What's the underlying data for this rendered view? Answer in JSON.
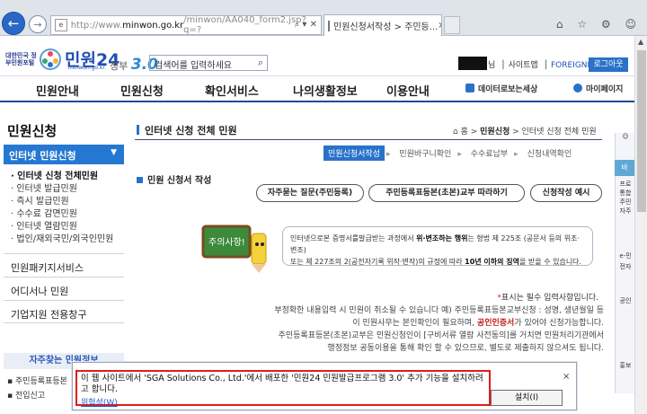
{
  "browser": {
    "url_prefix": "http://www.",
    "url_domain": "minwon.go.kr",
    "url_path": "/minwon/AA040_form2.jsp?q=?",
    "tab_title": "민원신청서작성 > 주민등...",
    "tab_close": "×",
    "tools": "⌂ ☆ ⚙ ☺"
  },
  "header": {
    "logo_org": "대한민국 정부민원포털",
    "logo_name": "민원24",
    "logo_url": "minwon.go.kr",
    "gov_label": "정부",
    "gov_version": "3.0",
    "search_placeholder": "검색어를 입력하세요",
    "user_suffix": "님",
    "util_links": [
      "사이트맵",
      "FOREIGNER"
    ],
    "login_button": "로그아웃"
  },
  "gnb": {
    "items": [
      "민원안내",
      "민원신청",
      "확인서비스",
      "나의생활정보",
      "이용안내"
    ],
    "right": [
      "데이터로보는세상",
      "마이페이지"
    ]
  },
  "sidebar": {
    "title": "민원신청",
    "active": "인터넷 민원신청",
    "subitems": [
      "인터넷 신청 전체민원",
      "인터넷 발급민원",
      "즉시 발급민원",
      "수수료 감면민원",
      "인터넷 열람민원",
      "법인/재외국민/외국인민원"
    ],
    "sections": [
      "민원패키지서비스",
      "어디서나 민원",
      "기업지원 전용창구"
    ],
    "faq_title": "자주찾는 민원정보",
    "faq_items": [
      "주민등록표등본",
      "전입신고"
    ]
  },
  "content": {
    "page_title": "인터넷 신청 전체 민원",
    "breadcrumb": [
      "홈",
      "민원신청",
      "인터넷 신청 전체 민원"
    ],
    "steps": [
      "민원신청서작성",
      "민원바구니확인",
      "수수료납부",
      "신청내역확인"
    ],
    "section_title": "민원 신청서 작성",
    "pills": [
      "자주묻는 질문(주민등록)",
      "주민등록표등본(초본)교부 따라하기",
      "신청작성 예시"
    ],
    "warning": {
      "line1_pre": "인터넷으로본 증명서를발급받는 과정에서 ",
      "line1_bold": "위·변조하는 행위",
      "line1_post": "는 형법 제 225조 (공문서 등의 위조·변조)",
      "line2_pre": "또는 제 227조의 2(공전자기록 위작·변작)의 규정에 따라 ",
      "line2_bold": "10년 이하의 징역",
      "line2_post": "을 받을 수 있습니다."
    },
    "required_star": "*",
    "required_text": "표시는 필수 입력사항입니다.",
    "body": [
      "부정확한 내용입력 시 민원이 취소될 수 있습니다  예) 주민등록표등본교부신청 : 성명, 생년월일 등",
      "이 민원사무는 본인확인이 필요하며, ",
      "공인인증서",
      "가 있어야 신청가능합니다.",
      "주민등록표등본(초본)교부은 민원신청인이 [구비서류 열람 사전동의]를 거치면 민원처리기관에서",
      "행정정보 공동이용을 통해 확인 할 수 있으므로, 별도로 제출하지 않으셔도 됩니다."
    ],
    "character_sign": "주의사항!"
  },
  "quick": {
    "items": [
      "바",
      "프로",
      "통합",
      "주민",
      "자주",
      "e-민",
      "전자",
      "공인",
      "홍보"
    ]
  },
  "notification": {
    "message": "이 웹 사이트에서 'SGA Solutions Co., Ltd.'에서 배포한 '민원24 민원발급프로그램 3.0' 추가 기능을 설치하려고 합니다.",
    "risk_link": "위험성(W)",
    "install_button": "설치(I)",
    "close": "×"
  },
  "colors": {
    "primary": "#2a72c9",
    "gnb_border": "#27469a",
    "alert": "#e21b1b"
  }
}
